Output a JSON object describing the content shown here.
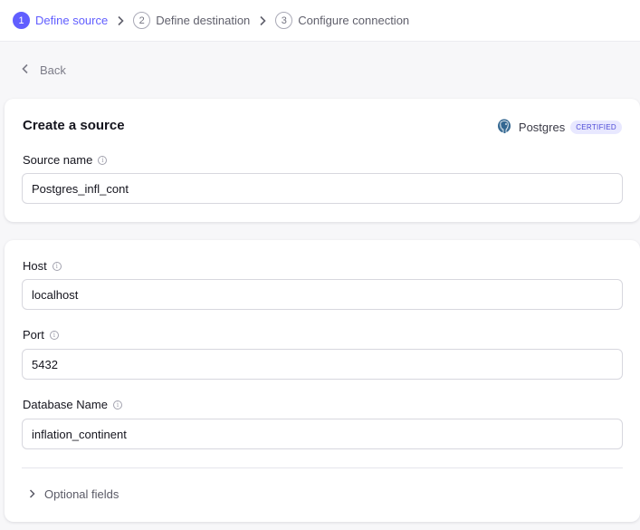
{
  "stepper": {
    "steps": [
      {
        "num": "1",
        "label": "Define source"
      },
      {
        "num": "2",
        "label": "Define destination"
      },
      {
        "num": "3",
        "label": "Configure connection"
      }
    ],
    "separator": "›"
  },
  "back": {
    "label": "Back",
    "icon": "chevron-left-icon"
  },
  "source_card": {
    "title": "Create a source",
    "connector_name": "Postgres",
    "badge": "CERTIFIED",
    "source_name_label": "Source name",
    "source_name_value": "Postgres_infl_cont"
  },
  "config_card": {
    "host_label": "Host",
    "host_value": "localhost",
    "port_label": "Port",
    "port_value": "5432",
    "database_label": "Database Name",
    "database_value": "inflation_continent",
    "optional_label": "Optional fields"
  },
  "colors": {
    "accent": "#615eff",
    "badge_bg": "#e8e8ff",
    "page_bg": "#f7f7f9"
  }
}
